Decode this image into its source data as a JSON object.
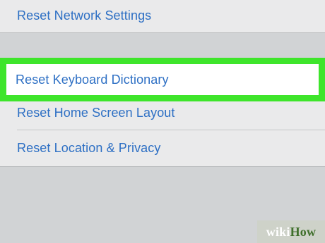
{
  "settings": {
    "reset_network": "Reset Network Settings",
    "reset_keyboard": "Reset Keyboard Dictionary",
    "reset_home_screen": "Reset Home Screen Layout",
    "reset_location": "Reset Location & Privacy"
  },
  "watermark": {
    "wiki": "wiki",
    "how": "How"
  },
  "colors": {
    "link_blue": "#2d6fc4",
    "highlight_green": "#3ee52b",
    "background_gray": "#d1d3d5",
    "group_background": "#eaeaeb"
  }
}
